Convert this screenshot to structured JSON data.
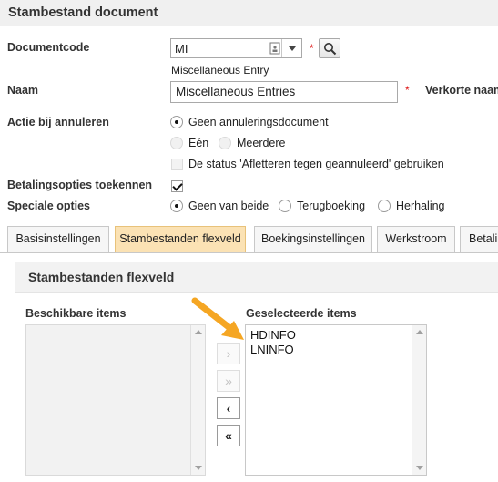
{
  "header": {
    "title": "Stambestand document"
  },
  "form": {
    "documentcode": {
      "label": "Documentcode",
      "value": "MI",
      "description": "Miscellaneous Entry",
      "required": "*"
    },
    "naam": {
      "label": "Naam",
      "value": "Miscellaneous Entries",
      "required": "*",
      "short_label": "Verkorte naam"
    },
    "actie": {
      "label": "Actie bij annuleren",
      "option_geen": "Geen annuleringsdocument",
      "option_een": "Eén",
      "option_meerdere": "Meerdere",
      "status_checkbox": "De status 'Afletteren tegen geannuleerd' gebruiken"
    },
    "betaling": {
      "label": "Betalingsopties toekennen",
      "checked": true
    },
    "speciale": {
      "label": "Speciale opties",
      "options": [
        "Geen van beide",
        "Terugboeking",
        "Herhaling"
      ],
      "selected": "Geen van beide"
    }
  },
  "tabs": [
    {
      "label": "Basisinstellingen",
      "active": false
    },
    {
      "label": "Stambestanden flexveld",
      "active": true
    },
    {
      "label": "Boekingsinstellingen",
      "active": false
    },
    {
      "label": "Werkstroom",
      "active": false
    },
    {
      "label": "Betali",
      "active": false
    }
  ],
  "panel": {
    "title": "Stambestanden flexveld",
    "available_label": "Beschikbare items",
    "available_items": [],
    "selected_label": "Geselecteerde items",
    "selected_items": [
      "HDINFO",
      "LNINFO"
    ],
    "move_buttons": [
      {
        "glyph": "›",
        "enabled": false
      },
      {
        "glyph": "»",
        "enabled": false
      },
      {
        "glyph": "‹",
        "enabled": true
      },
      {
        "glyph": "«",
        "enabled": true
      }
    ]
  },
  "icons": {
    "lookup": "lookup-icon",
    "dropdown": "chevron-down-icon",
    "search": "search-icon",
    "arrow": "annotation-arrow"
  },
  "colors": {
    "active_tab": "#fbe2b4",
    "required": "#dd1111",
    "annotation_arrow": "#f5a623",
    "header_bg": "#f0f0f0"
  }
}
